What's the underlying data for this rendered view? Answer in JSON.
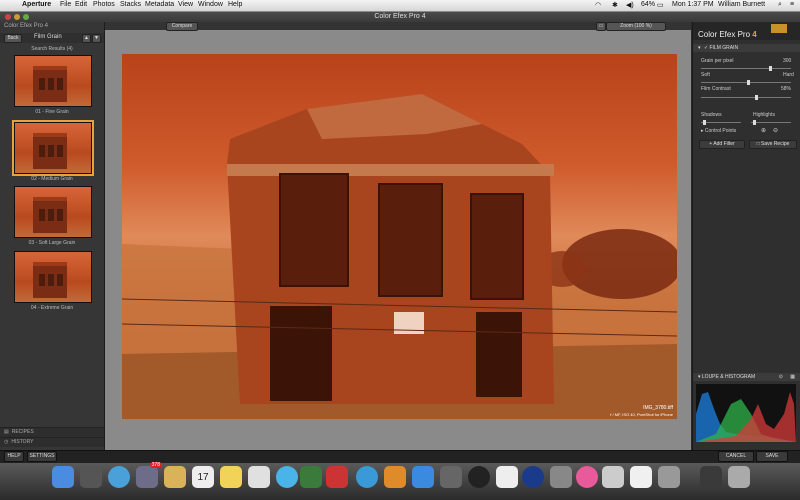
{
  "menubar": {
    "app": "Aperture",
    "items": [
      "File",
      "Edit",
      "Photos",
      "Stacks",
      "Metadata",
      "View",
      "Window",
      "Help"
    ],
    "battery": "64%",
    "time": "Mon 1:37 PM",
    "user": "William Burnett"
  },
  "window": {
    "title": "Color Efex Pro 4"
  },
  "left_panel": {
    "title": "Color Efex Pro 4",
    "back_label": "Back",
    "filter_name": "Film Grain",
    "search_results": "Search Results (4)",
    "thumbnails": [
      {
        "label": "01 - Fine Grain",
        "selected": false
      },
      {
        "label": "02 - Medium Grain",
        "selected": true
      },
      {
        "label": "03 - Soft Large Grain",
        "selected": false
      },
      {
        "label": "04 - Extreme Grain",
        "selected": false
      }
    ],
    "recipes": "RECIPES",
    "history": "HISTORY"
  },
  "toolbar": {
    "compare": "Compare",
    "zoom": "Zoom (100 %)"
  },
  "photo": {
    "filename": "IMG_3780.tiff",
    "meta": "f / MF, ISO 40, PureShot for iPhone"
  },
  "right_panel": {
    "logo_text": "Color Efex Pro ",
    "logo_version": "4",
    "filter_section": "FILM GRAIN",
    "grain_per_pixel_label": "Grain per pixel",
    "grain_per_pixel_value": "300",
    "soft_label": "Soft",
    "hard_label": "Hard",
    "film_contrast_label": "Film Contrast",
    "film_contrast_value": "58%",
    "shadows_label": "Shadows",
    "highlights_label": "Highlights",
    "control_points_label": "Control Points",
    "add_filter": "Add Filter",
    "save_recipe": "Save Recipe",
    "loupe_section": "LOUPE & HISTOGRAM"
  },
  "bottom": {
    "help": "HELP",
    "settings": "SETTINGS",
    "cancel": "CANCEL",
    "save": "SAVE"
  },
  "dock": {
    "badge_mail": "378",
    "calendar_day": "17"
  }
}
